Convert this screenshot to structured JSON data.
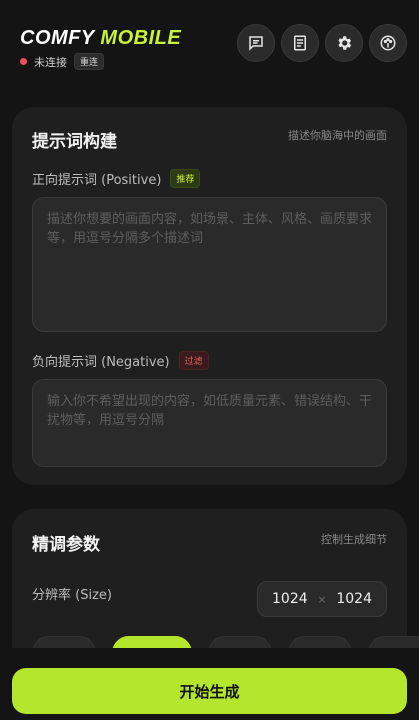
{
  "header": {
    "brand_part1": "COMFY",
    "brand_part2": "MOBILE",
    "status_text": "未连接",
    "reconnect_label": "重连",
    "icons": [
      "chat-icon",
      "notes-icon",
      "gear-icon",
      "palette-icon"
    ]
  },
  "prompt_card": {
    "title": "提示词构建",
    "subtitle": "描述你脑海中的画面",
    "positive": {
      "label": "正向提示词 (Positive)",
      "tag": "推荐",
      "placeholder": "描述你想要的画面内容，如场景、主体、风格、画质要求等，用逗号分隔多个描述词"
    },
    "negative": {
      "label": "负向提示词 (Negative)",
      "tag": "过滤",
      "placeholder": "输入你不希望出现的内容，如低质量元素、错误结构、干扰物等，用逗号分隔"
    }
  },
  "params_card": {
    "title": "精调参数",
    "subtitle": "控制生成细节",
    "size_label": "分辨率 (Size)",
    "width": "1024",
    "height": "1024",
    "separator": "×"
  },
  "generate_label": "开始生成",
  "colors": {
    "accent": "#b5e62e",
    "status_disconnected": "#ef4e5a"
  }
}
